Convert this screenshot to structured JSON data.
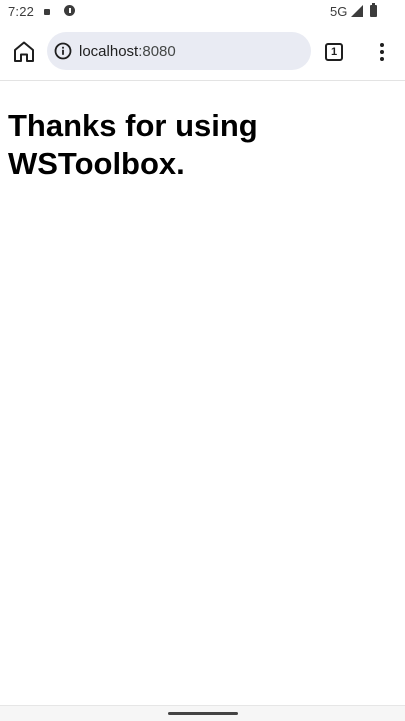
{
  "status_bar": {
    "time": "7:22",
    "network": "5G",
    "icons": [
      "notification-square-icon",
      "info-icon",
      "signal-icon",
      "battery-icon"
    ]
  },
  "browser": {
    "url_host": "localhost",
    "url_port": ":8080",
    "tab_count": "1",
    "icons": [
      "home-icon",
      "site-info-icon",
      "tabs-icon",
      "more-vert-icon"
    ]
  },
  "page": {
    "heading": "Thanks for using WSToolbox."
  },
  "colors": {
    "url_bar_bg": "#e9ebf3",
    "text": "#1f1f1f",
    "heading": "#000000"
  }
}
